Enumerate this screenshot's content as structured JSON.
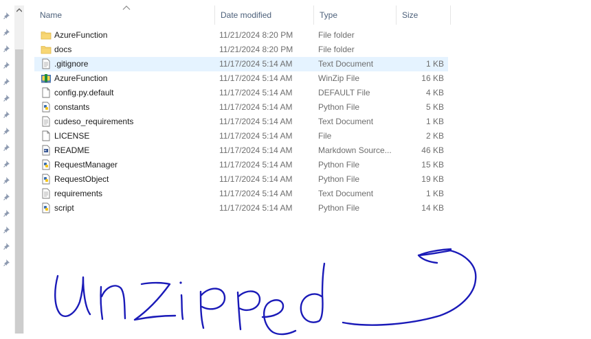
{
  "columns": {
    "name": "Name",
    "date": "Date modified",
    "type": "Type",
    "size": "Size"
  },
  "files": [
    {
      "name": "AzureFunction",
      "date": "11/21/2024 8:20 PM",
      "type": "File folder",
      "size": "",
      "icon": "folder-icon"
    },
    {
      "name": "docs",
      "date": "11/21/2024 8:20 PM",
      "type": "File folder",
      "size": "",
      "icon": "folder-icon"
    },
    {
      "name": ".gitignore",
      "date": "11/17/2024 5:14 AM",
      "type": "Text Document",
      "size": "1 KB",
      "icon": "text-file-icon",
      "selected": true
    },
    {
      "name": "AzureFunction",
      "date": "11/17/2024 5:14 AM",
      "type": "WinZip File",
      "size": "16 KB",
      "icon": "winzip-icon"
    },
    {
      "name": "config.py.default",
      "date": "11/17/2024 5:14 AM",
      "type": "DEFAULT File",
      "size": "4 KB",
      "icon": "blank-file-icon"
    },
    {
      "name": "constants",
      "date": "11/17/2024 5:14 AM",
      "type": "Python File",
      "size": "5 KB",
      "icon": "python-file-icon"
    },
    {
      "name": "cudeso_requirements",
      "date": "11/17/2024 5:14 AM",
      "type": "Text Document",
      "size": "1 KB",
      "icon": "text-file-icon"
    },
    {
      "name": "LICENSE",
      "date": "11/17/2024 5:14 AM",
      "type": "File",
      "size": "2 KB",
      "icon": "blank-file-icon"
    },
    {
      "name": "README",
      "date": "11/17/2024 5:14 AM",
      "type": "Markdown Source...",
      "size": "46 KB",
      "icon": "markdown-file-icon"
    },
    {
      "name": "RequestManager",
      "date": "11/17/2024 5:14 AM",
      "type": "Python File",
      "size": "15 KB",
      "icon": "python-file-icon"
    },
    {
      "name": "RequestObject",
      "date": "11/17/2024 5:14 AM",
      "type": "Python File",
      "size": "19 KB",
      "icon": "python-file-icon"
    },
    {
      "name": "requirements",
      "date": "11/17/2024 5:14 AM",
      "type": "Text Document",
      "size": "1 KB",
      "icon": "text-file-icon"
    },
    {
      "name": "script",
      "date": "11/17/2024 5:14 AM",
      "type": "Python File",
      "size": "14 KB",
      "icon": "python-file-icon"
    }
  ],
  "annotation": {
    "text": "unzipped",
    "color": "#1a1ab8"
  },
  "colors": {
    "selected_row": "#e5f3ff",
    "header_text": "#4c607a",
    "folder": "#f8d775"
  }
}
